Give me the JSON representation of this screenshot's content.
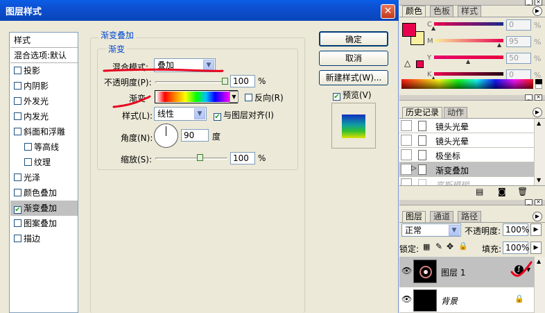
{
  "dialog": {
    "title": "图层样式",
    "close_label": "✕",
    "style_list": [
      {
        "label": "样式",
        "header": true,
        "checkbox": false,
        "selected": false,
        "checked": false,
        "indent": false
      },
      {
        "label": "混合选项:默认",
        "header": true,
        "checkbox": false,
        "selected": false,
        "checked": false,
        "indent": false
      },
      {
        "label": "投影",
        "checkbox": true,
        "checked": false,
        "indent": false
      },
      {
        "label": "内阴影",
        "checkbox": true,
        "checked": false,
        "indent": false
      },
      {
        "label": "外发光",
        "checkbox": true,
        "checked": false,
        "indent": false
      },
      {
        "label": "内发光",
        "checkbox": true,
        "checked": false,
        "indent": false
      },
      {
        "label": "斜面和浮雕",
        "checkbox": true,
        "checked": false,
        "indent": false
      },
      {
        "label": "等高线",
        "checkbox": true,
        "checked": false,
        "indent": true
      },
      {
        "label": "纹理",
        "checkbox": true,
        "checked": false,
        "indent": true
      },
      {
        "label": "光泽",
        "checkbox": true,
        "checked": false,
        "indent": false
      },
      {
        "label": "颜色叠加",
        "checkbox": true,
        "checked": false,
        "indent": false
      },
      {
        "label": "渐变叠加",
        "checkbox": true,
        "checked": true,
        "selected": true,
        "indent": false
      },
      {
        "label": "图案叠加",
        "checkbox": true,
        "checked": false,
        "indent": false
      },
      {
        "label": "描边",
        "checkbox": true,
        "checked": false,
        "indent": false
      }
    ],
    "gradient_overlay": {
      "group_title": "渐变叠加",
      "subgroup_title": "渐变",
      "blend_mode_label": "混合模式:",
      "blend_mode_value": "叠加",
      "opacity_label": "不透明度(P):",
      "opacity_value": "100",
      "opacity_fraction": 1.0,
      "percent": "%",
      "gradient_label": "渐变",
      "reverse_label": "反向(R)",
      "style_label": "样式(L):",
      "style_value": "线性",
      "align_label": "与图层对齐(I)",
      "angle_label": "角度(N):",
      "angle_value": "90",
      "angle_unit": "度",
      "scale_label": "缩放(S):",
      "scale_value": "100",
      "scale_fraction": 0.5
    },
    "buttons": {
      "ok": "确定",
      "cancel": "取消",
      "new_style": "新建样式(W)...",
      "preview": "预览(V)"
    }
  },
  "color_panel": {
    "tabs": [
      "颜色",
      "色板",
      "样式"
    ],
    "channels": [
      {
        "label": "C",
        "value": "0",
        "unit": "%",
        "fraction": 0.0
      },
      {
        "label": "M",
        "value": "95",
        "unit": "%",
        "fraction": 0.95
      },
      {
        "label": "Y",
        "value": "50",
        "unit": "%",
        "fraction": 0.5
      },
      {
        "label": "K",
        "value": "0",
        "unit": "%",
        "fraction": 0.0
      }
    ],
    "foreground": "#e8004f",
    "background": "#f8f0a0"
  },
  "history_panel": {
    "tabs": [
      "历史记录",
      "动作"
    ],
    "items": [
      "镜头光晕",
      "镜头光晕",
      "极坐标",
      "渐变叠加",
      "高斯模糊"
    ]
  },
  "layers_panel": {
    "tabs": [
      "图层",
      "通道",
      "路径"
    ],
    "blend_mode": "正常",
    "opacity_label": "不透明度:",
    "opacity_value": "100%",
    "lock_label": "锁定:",
    "fill_label": "填充:",
    "fill_value": "100%",
    "layers": [
      {
        "name": "图层 1"
      },
      {
        "name": "背景"
      }
    ]
  }
}
